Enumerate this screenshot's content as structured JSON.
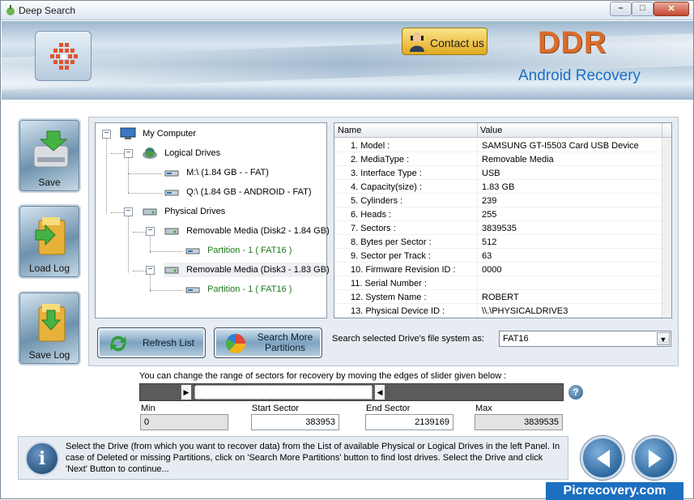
{
  "window": {
    "title": "Deep Search"
  },
  "header": {
    "contact_label": "Contact us",
    "brand": "DDR",
    "product": "Android Recovery"
  },
  "side_buttons": {
    "save": "Save",
    "load_log": "Load Log",
    "save_log": "Save Log"
  },
  "tree": {
    "root": "My Computer",
    "logical_drives": "Logical Drives",
    "logical": [
      "M:\\ (1.84 GB -  - FAT)",
      "Q:\\ (1.84 GB - ANDROID - FAT)"
    ],
    "physical_drives": "Physical Drives",
    "media": [
      {
        "label": "Removable Media (Disk2 - 1.84 GB)",
        "partition": "Partition - 1 ( FAT16 )"
      },
      {
        "label": "Removable Media (Disk3 - 1.83 GB)",
        "partition": "Partition - 1 ( FAT16 )"
      }
    ]
  },
  "grid": {
    "headers": [
      "Name",
      "Value"
    ],
    "rows": [
      {
        "name": "1. Model :",
        "value": "SAMSUNG GT-I5503 Card USB Device"
      },
      {
        "name": "2. MediaType :",
        "value": "Removable Media"
      },
      {
        "name": "3. Interface Type :",
        "value": "USB"
      },
      {
        "name": "4. Capacity(size) :",
        "value": "1.83 GB"
      },
      {
        "name": "5. Cylinders :",
        "value": "239"
      },
      {
        "name": "6. Heads :",
        "value": "255"
      },
      {
        "name": "7. Sectors :",
        "value": "3839535"
      },
      {
        "name": "8. Bytes per Sector :",
        "value": "512"
      },
      {
        "name": "9. Sector per Track :",
        "value": "63"
      },
      {
        "name": "10. Firmware Revision ID :",
        "value": "0000"
      },
      {
        "name": "11. Serial Number :",
        "value": ""
      },
      {
        "name": "12. System Name :",
        "value": "ROBERT"
      },
      {
        "name": "13. Physical Device ID :",
        "value": "\\\\.\\PHYSICALDRIVE3"
      }
    ]
  },
  "actions": {
    "refresh": "Refresh List",
    "search_more_1": "Search More",
    "search_more_2": "Partitions"
  },
  "filesystem": {
    "label": "Search selected Drive's file system as:",
    "selected": "FAT16"
  },
  "range": {
    "caption": "You can change the range of sectors for recovery by moving the edges of slider given below :",
    "min_label": "Min",
    "min": "0",
    "start_label": "Start Sector",
    "start": "383953",
    "end_label": "End Sector",
    "end": "2139169",
    "max_label": "Max",
    "max": "3839535"
  },
  "info": {
    "text": "Select the Drive (from which you want to recover data) from the List of available Physical or Logical Drives in the left Panel. In case of Deleted or missing Partitions, click on 'Search More Partitions' button to find lost drives. Select the Drive and click 'Next' Button to continue..."
  },
  "footer": "Picrecovery.com"
}
